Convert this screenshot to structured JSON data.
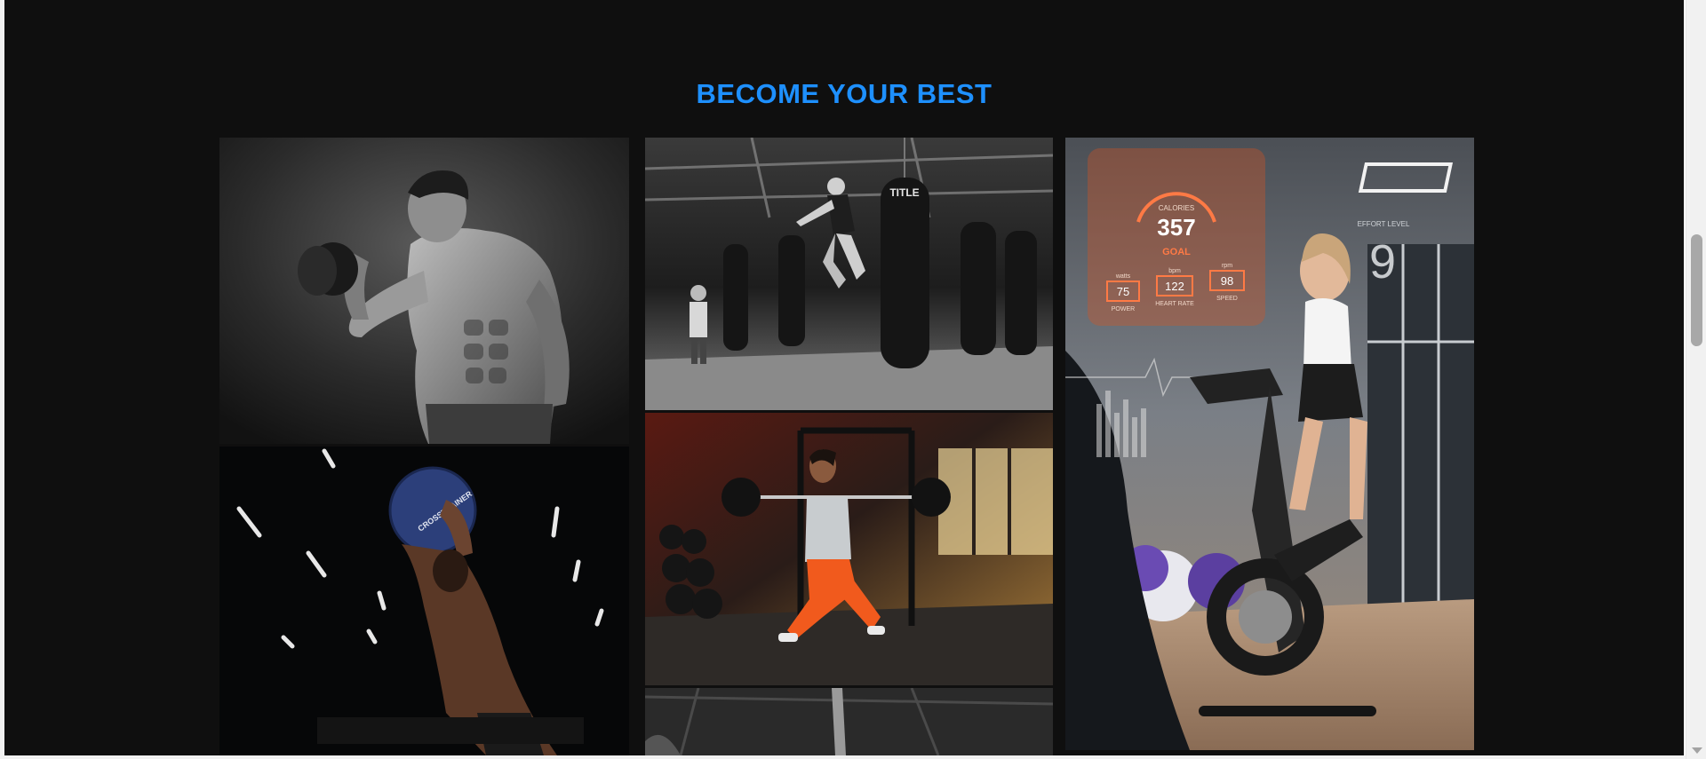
{
  "section": {
    "title": "BECOME YOUR BEST"
  },
  "gallery": {
    "tiles": [
      {
        "subject": "Shirtless man curling a dumbbell, black and white"
      },
      {
        "subject": "Fighter jump-kicking heavy bags in a boxing gym, black and white",
        "bag_brand": "TITLE"
      },
      {
        "subject": "Woman on a stationary bike with fitness HUD overlay"
      },
      {
        "subject": "Athlete throwing a medicine ball overhead",
        "ball_text": "CROSSTRAINER"
      },
      {
        "subject": "Woman doing a barbell lunge in a weight room"
      },
      {
        "subject": "Gym interior with ropes, partially visible"
      }
    ],
    "hud": {
      "calories_label": "CALORIES",
      "calories_value": "357",
      "goal_label": "GOAL",
      "effort_label": "EFFORT LEVEL",
      "effort_value": "9",
      "power_unit": "watts",
      "power_value": "75",
      "power_label": "POWER",
      "heart_unit": "bpm",
      "heart_value": "122",
      "heart_label": "HEART RATE",
      "speed_unit": "rpm",
      "speed_value": "98",
      "speed_label": "SPEED"
    }
  },
  "colors": {
    "background": "#0f0f0f",
    "title_accent": "#1e90ff",
    "hud_orange": "#ff7a45"
  }
}
